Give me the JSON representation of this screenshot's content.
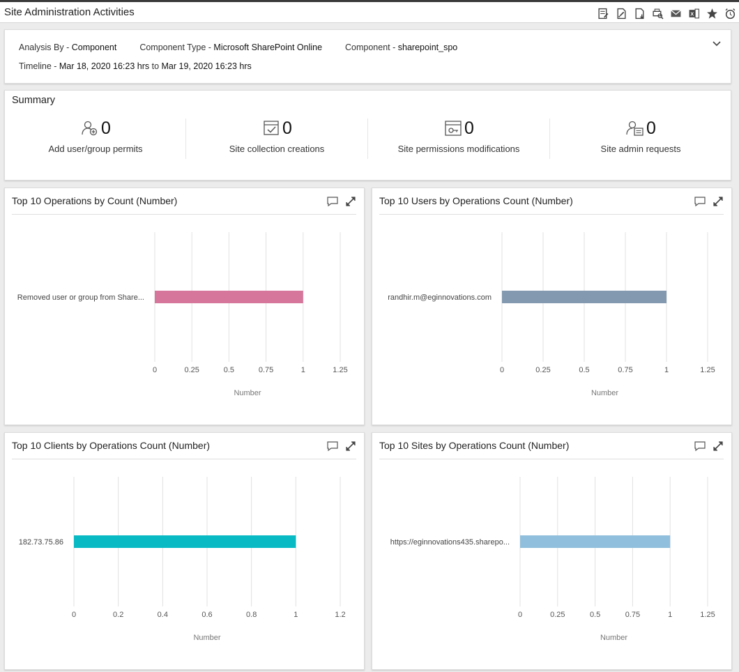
{
  "page": {
    "title": "Site Administration Activities"
  },
  "toolbar": {
    "icons": [
      "report-icon",
      "edit-report-icon",
      "pdf-export-icon",
      "print-preview-icon",
      "email-icon",
      "excel-export-icon",
      "favorite-star-icon",
      "schedule-alarm-icon"
    ]
  },
  "filters": {
    "analysis_by_label": "Analysis By - ",
    "analysis_by_value": "Component",
    "component_type_label": "Component Type - ",
    "component_type_value": "Microsoft SharePoint Online",
    "component_label": "Component - ",
    "component_value": "sharepoint_spo",
    "timeline_label": "Timeline - ",
    "timeline_from": "Mar 18, 2020 16:23 hrs",
    "timeline_to_word": " to ",
    "timeline_to": "Mar 19, 2020 16:23 hrs"
  },
  "summary": {
    "title": "Summary",
    "items": [
      {
        "value": "0",
        "label": "Add user/group permits",
        "icon": "user-add-icon"
      },
      {
        "value": "0",
        "label": "Site collection creations",
        "icon": "calendar-check-icon"
      },
      {
        "value": "0",
        "label": "Site permissions modifications",
        "icon": "window-key-icon"
      },
      {
        "value": "0",
        "label": "Site admin requests",
        "icon": "user-card-icon"
      }
    ]
  },
  "chart_data": [
    {
      "type": "bar",
      "orientation": "horizontal",
      "title": "Top 10 Operations by Count (Number)",
      "categories": [
        "Removed user or group from Share..."
      ],
      "values": [
        1
      ],
      "xlabel": "Number",
      "xlim": [
        0,
        1.25
      ],
      "ticks": [
        "0",
        "0.25",
        "0.5",
        "0.75",
        "1",
        "1.25"
      ],
      "color": "#d5769a",
      "grid": true
    },
    {
      "type": "bar",
      "orientation": "horizontal",
      "title": "Top 10 Users by Operations Count (Number)",
      "categories": [
        "randhir.m@eginnovations.com"
      ],
      "values": [
        1
      ],
      "xlabel": "Number",
      "xlim": [
        0,
        1.25
      ],
      "ticks": [
        "0",
        "0.25",
        "0.5",
        "0.75",
        "1",
        "1.25"
      ],
      "color": "#8399b0",
      "grid": true
    },
    {
      "type": "bar",
      "orientation": "horizontal",
      "title": "Top 10 Clients by Operations Count (Number)",
      "categories": [
        "182.73.75.86"
      ],
      "values": [
        1
      ],
      "xlabel": "Number",
      "xlim": [
        0,
        1.2
      ],
      "ticks": [
        "0",
        "0.2",
        "0.4",
        "0.6",
        "0.8",
        "1",
        "1.2"
      ],
      "color": "#07bac4",
      "grid": true
    },
    {
      "type": "bar",
      "orientation": "horizontal",
      "title": "Top 10 Sites by Operations Count (Number)",
      "categories": [
        "https://eginnovations435.sharepo..."
      ],
      "values": [
        1
      ],
      "xlabel": "Number",
      "xlim": [
        0,
        1.25
      ],
      "ticks": [
        "0",
        "0.25",
        "0.5",
        "0.75",
        "1",
        "1.25"
      ],
      "color": "#8fbfdc",
      "grid": true
    }
  ]
}
